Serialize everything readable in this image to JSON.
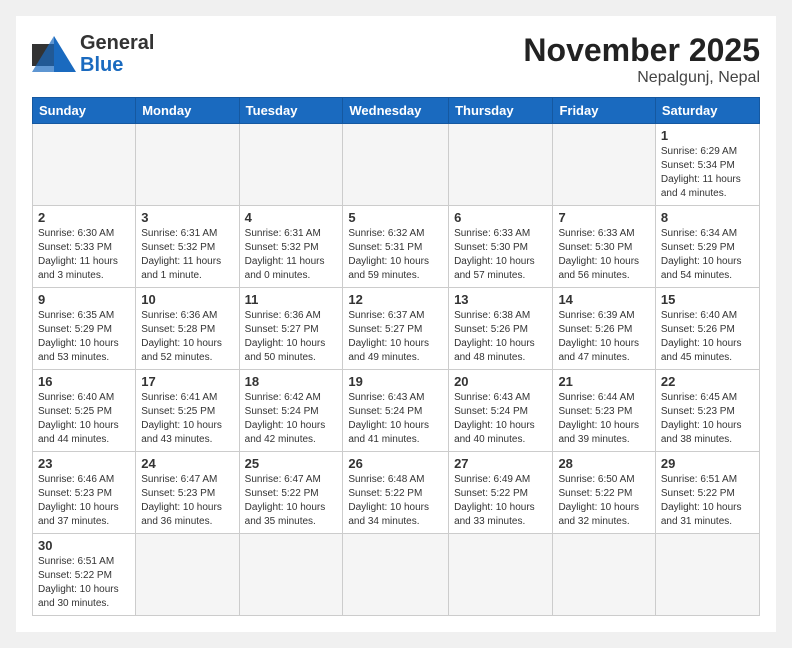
{
  "header": {
    "logo_general": "General",
    "logo_blue": "Blue",
    "title": "November 2025",
    "subtitle": "Nepalgunj, Nepal"
  },
  "weekdays": [
    "Sunday",
    "Monday",
    "Tuesday",
    "Wednesday",
    "Thursday",
    "Friday",
    "Saturday"
  ],
  "weeks": [
    [
      null,
      null,
      null,
      null,
      null,
      null,
      {
        "day": 1,
        "sunrise": "6:29 AM",
        "sunset": "5:34 PM",
        "daylight": "11 hours and 4 minutes."
      }
    ],
    [
      {
        "day": 2,
        "sunrise": "6:30 AM",
        "sunset": "5:33 PM",
        "daylight": "11 hours and 3 minutes."
      },
      {
        "day": 3,
        "sunrise": "6:31 AM",
        "sunset": "5:32 PM",
        "daylight": "11 hours and 1 minute."
      },
      {
        "day": 4,
        "sunrise": "6:31 AM",
        "sunset": "5:32 PM",
        "daylight": "11 hours and 0 minutes."
      },
      {
        "day": 5,
        "sunrise": "6:32 AM",
        "sunset": "5:31 PM",
        "daylight": "10 hours and 59 minutes."
      },
      {
        "day": 6,
        "sunrise": "6:33 AM",
        "sunset": "5:30 PM",
        "daylight": "10 hours and 57 minutes."
      },
      {
        "day": 7,
        "sunrise": "6:33 AM",
        "sunset": "5:30 PM",
        "daylight": "10 hours and 56 minutes."
      },
      {
        "day": 8,
        "sunrise": "6:34 AM",
        "sunset": "5:29 PM",
        "daylight": "10 hours and 54 minutes."
      }
    ],
    [
      {
        "day": 9,
        "sunrise": "6:35 AM",
        "sunset": "5:29 PM",
        "daylight": "10 hours and 53 minutes."
      },
      {
        "day": 10,
        "sunrise": "6:36 AM",
        "sunset": "5:28 PM",
        "daylight": "10 hours and 52 minutes."
      },
      {
        "day": 11,
        "sunrise": "6:36 AM",
        "sunset": "5:27 PM",
        "daylight": "10 hours and 50 minutes."
      },
      {
        "day": 12,
        "sunrise": "6:37 AM",
        "sunset": "5:27 PM",
        "daylight": "10 hours and 49 minutes."
      },
      {
        "day": 13,
        "sunrise": "6:38 AM",
        "sunset": "5:26 PM",
        "daylight": "10 hours and 48 minutes."
      },
      {
        "day": 14,
        "sunrise": "6:39 AM",
        "sunset": "5:26 PM",
        "daylight": "10 hours and 47 minutes."
      },
      {
        "day": 15,
        "sunrise": "6:40 AM",
        "sunset": "5:26 PM",
        "daylight": "10 hours and 45 minutes."
      }
    ],
    [
      {
        "day": 16,
        "sunrise": "6:40 AM",
        "sunset": "5:25 PM",
        "daylight": "10 hours and 44 minutes."
      },
      {
        "day": 17,
        "sunrise": "6:41 AM",
        "sunset": "5:25 PM",
        "daylight": "10 hours and 43 minutes."
      },
      {
        "day": 18,
        "sunrise": "6:42 AM",
        "sunset": "5:24 PM",
        "daylight": "10 hours and 42 minutes."
      },
      {
        "day": 19,
        "sunrise": "6:43 AM",
        "sunset": "5:24 PM",
        "daylight": "10 hours and 41 minutes."
      },
      {
        "day": 20,
        "sunrise": "6:43 AM",
        "sunset": "5:24 PM",
        "daylight": "10 hours and 40 minutes."
      },
      {
        "day": 21,
        "sunrise": "6:44 AM",
        "sunset": "5:23 PM",
        "daylight": "10 hours and 39 minutes."
      },
      {
        "day": 22,
        "sunrise": "6:45 AM",
        "sunset": "5:23 PM",
        "daylight": "10 hours and 38 minutes."
      }
    ],
    [
      {
        "day": 23,
        "sunrise": "6:46 AM",
        "sunset": "5:23 PM",
        "daylight": "10 hours and 37 minutes."
      },
      {
        "day": 24,
        "sunrise": "6:47 AM",
        "sunset": "5:23 PM",
        "daylight": "10 hours and 36 minutes."
      },
      {
        "day": 25,
        "sunrise": "6:47 AM",
        "sunset": "5:22 PM",
        "daylight": "10 hours and 35 minutes."
      },
      {
        "day": 26,
        "sunrise": "6:48 AM",
        "sunset": "5:22 PM",
        "daylight": "10 hours and 34 minutes."
      },
      {
        "day": 27,
        "sunrise": "6:49 AM",
        "sunset": "5:22 PM",
        "daylight": "10 hours and 33 minutes."
      },
      {
        "day": 28,
        "sunrise": "6:50 AM",
        "sunset": "5:22 PM",
        "daylight": "10 hours and 32 minutes."
      },
      {
        "day": 29,
        "sunrise": "6:51 AM",
        "sunset": "5:22 PM",
        "daylight": "10 hours and 31 minutes."
      }
    ],
    [
      {
        "day": 30,
        "sunrise": "6:51 AM",
        "sunset": "5:22 PM",
        "daylight": "10 hours and 30 minutes."
      },
      null,
      null,
      null,
      null,
      null,
      null
    ]
  ]
}
